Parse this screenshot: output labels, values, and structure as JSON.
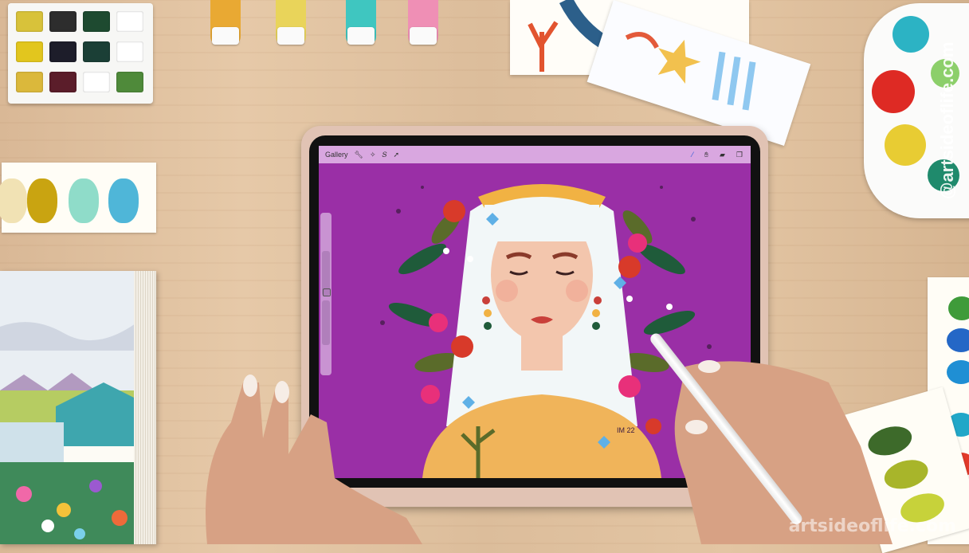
{
  "procreate": {
    "gallery_label": "Gallery",
    "toolbar_left_icons": [
      "wrench-icon",
      "magic-wand-icon",
      "selection-icon",
      "transform-icon"
    ],
    "toolbar_right_icons": [
      "brush-icon",
      "smudge-icon",
      "eraser-icon",
      "layers-icon"
    ],
    "canvas_signature": "IM 22"
  },
  "watermarks": {
    "vertical": "@artsideoflife.com",
    "bottom": "artsideoflife.com"
  },
  "colors": {
    "canvas_background": "#9a2fa6",
    "toolbar": "#d9a7e0",
    "hair": "#f2f7f8",
    "headband": "#f1b243",
    "skin": "#f3c6ad",
    "shirt": "#f0b45a",
    "case": "#e1c3b4"
  }
}
